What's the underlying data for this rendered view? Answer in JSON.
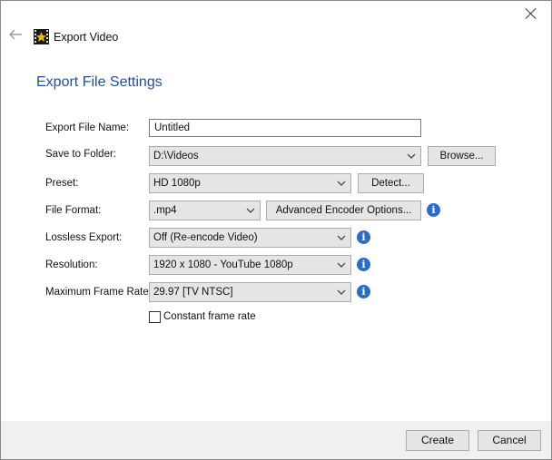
{
  "window": {
    "title": "Export Video"
  },
  "header": "Export File Settings",
  "fields": {
    "file_name": {
      "label": "Export File Name:",
      "value": "Untitled"
    },
    "save_to_folder": {
      "label": "Save to Folder:",
      "value": "D:\\Videos",
      "button": "Browse..."
    },
    "preset": {
      "label": "Preset:",
      "value": "HD 1080p",
      "button": "Detect..."
    },
    "file_format": {
      "label": "File Format:",
      "value": ".mp4",
      "button": "Advanced Encoder Options..."
    },
    "lossless_export": {
      "label": "Lossless Export:",
      "value": "Off (Re-encode Video)"
    },
    "resolution": {
      "label": "Resolution:",
      "value": "1920 x 1080 - YouTube 1080p"
    },
    "max_frame_rate": {
      "label": "Maximum Frame Rate:",
      "value": "29.97 [TV NTSC]"
    }
  },
  "constant_frame_rate": {
    "label": "Constant frame rate",
    "checked": false
  },
  "footer": {
    "create": "Create",
    "cancel": "Cancel"
  },
  "colors": {
    "header": "#1f4e9e",
    "info_icon": "#2b6cc4",
    "footer_bg": "#f0f0f0",
    "control_bg": "#e5e5e5"
  },
  "icons": [
    "close-icon",
    "back-arrow-icon",
    "app-logo-icon",
    "chevron-down-icon",
    "info-icon"
  ]
}
